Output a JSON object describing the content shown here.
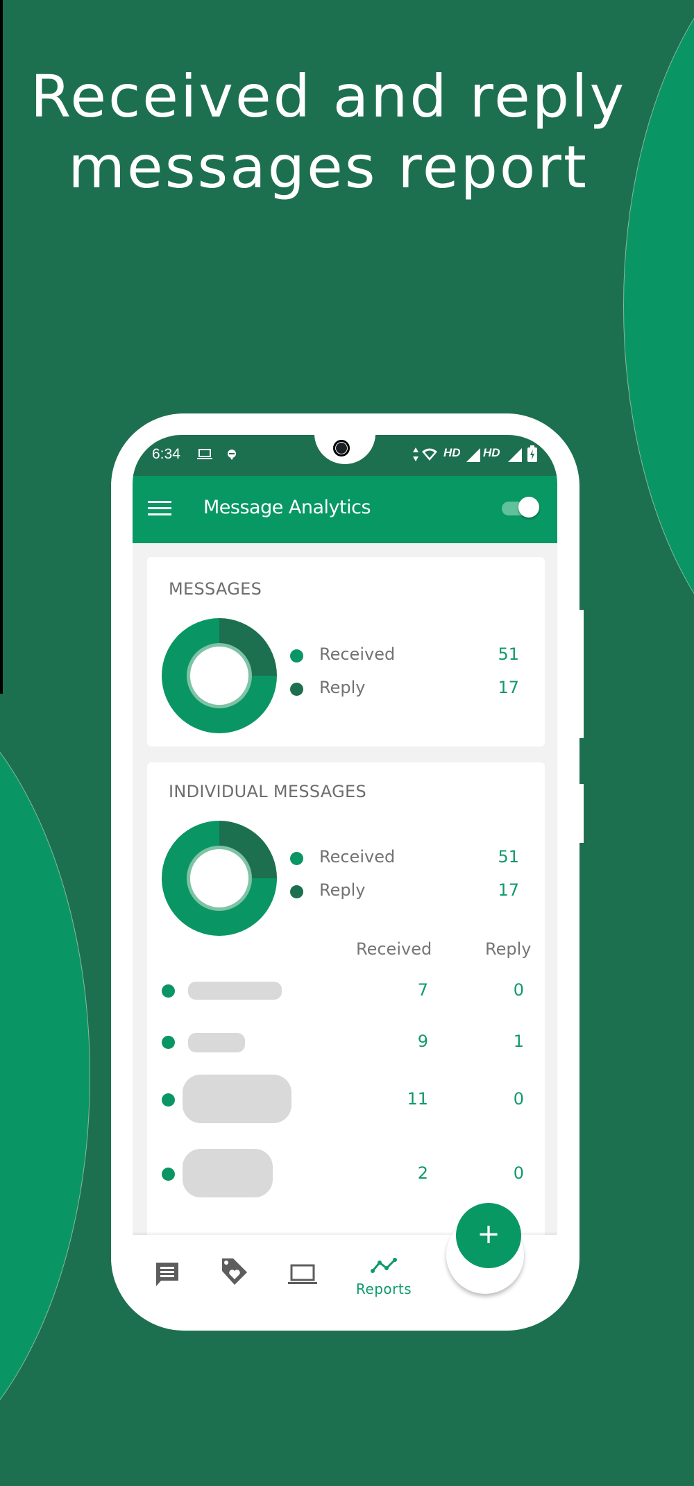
{
  "headline": {
    "line1": "Received and reply",
    "line2": "messages report"
  },
  "colors": {
    "background": "#1d704f",
    "accent": "#089863",
    "received": "#0a9664",
    "reply": "#1d704f"
  },
  "status_bar": {
    "time": "6:34",
    "left_icons": [
      "laptop-icon",
      "notification-icon"
    ],
    "right_icons": [
      "data-arrows-icon",
      "wifi-icon",
      "hd-label",
      "signal-icon",
      "hd-label",
      "signal-icon",
      "battery-charging-icon"
    ],
    "hd_label": "HD"
  },
  "app_bar": {
    "title": "Message Analytics",
    "menu_icon": "hamburger-menu-icon",
    "toggle_on": true
  },
  "messages_card": {
    "title": "MESSAGES",
    "legend": [
      {
        "label": "Received",
        "value": "51"
      },
      {
        "label": "Reply",
        "value": "17"
      }
    ]
  },
  "individual_card": {
    "title": "INDIVIDUAL MESSAGES",
    "legend": [
      {
        "label": "Received",
        "value": "51"
      },
      {
        "label": "Reply",
        "value": "17"
      }
    ],
    "columns": {
      "received": "Received",
      "reply": "Reply"
    },
    "rows": [
      {
        "name": "",
        "received": "7",
        "reply": "0"
      },
      {
        "name": "",
        "received": "9",
        "reply": "1"
      },
      {
        "name": "",
        "received": "11",
        "reply": "0"
      },
      {
        "name": "",
        "received": "2",
        "reply": "0"
      }
    ]
  },
  "chart_data": [
    {
      "type": "pie",
      "title": "MESSAGES",
      "categories": [
        "Received",
        "Reply"
      ],
      "values": [
        51,
        17
      ],
      "donut": true
    },
    {
      "type": "pie",
      "title": "INDIVIDUAL MESSAGES",
      "categories": [
        "Received",
        "Reply"
      ],
      "values": [
        51,
        17
      ],
      "donut": true
    }
  ],
  "fab": {
    "label": "+"
  },
  "bottom_nav": {
    "items": [
      {
        "icon": "chat-icon",
        "label": ""
      },
      {
        "icon": "tag-heart-icon",
        "label": ""
      },
      {
        "icon": "laptop-icon",
        "label": ""
      },
      {
        "icon": "reports-trend-icon",
        "label": "Reports",
        "active": true
      }
    ]
  }
}
